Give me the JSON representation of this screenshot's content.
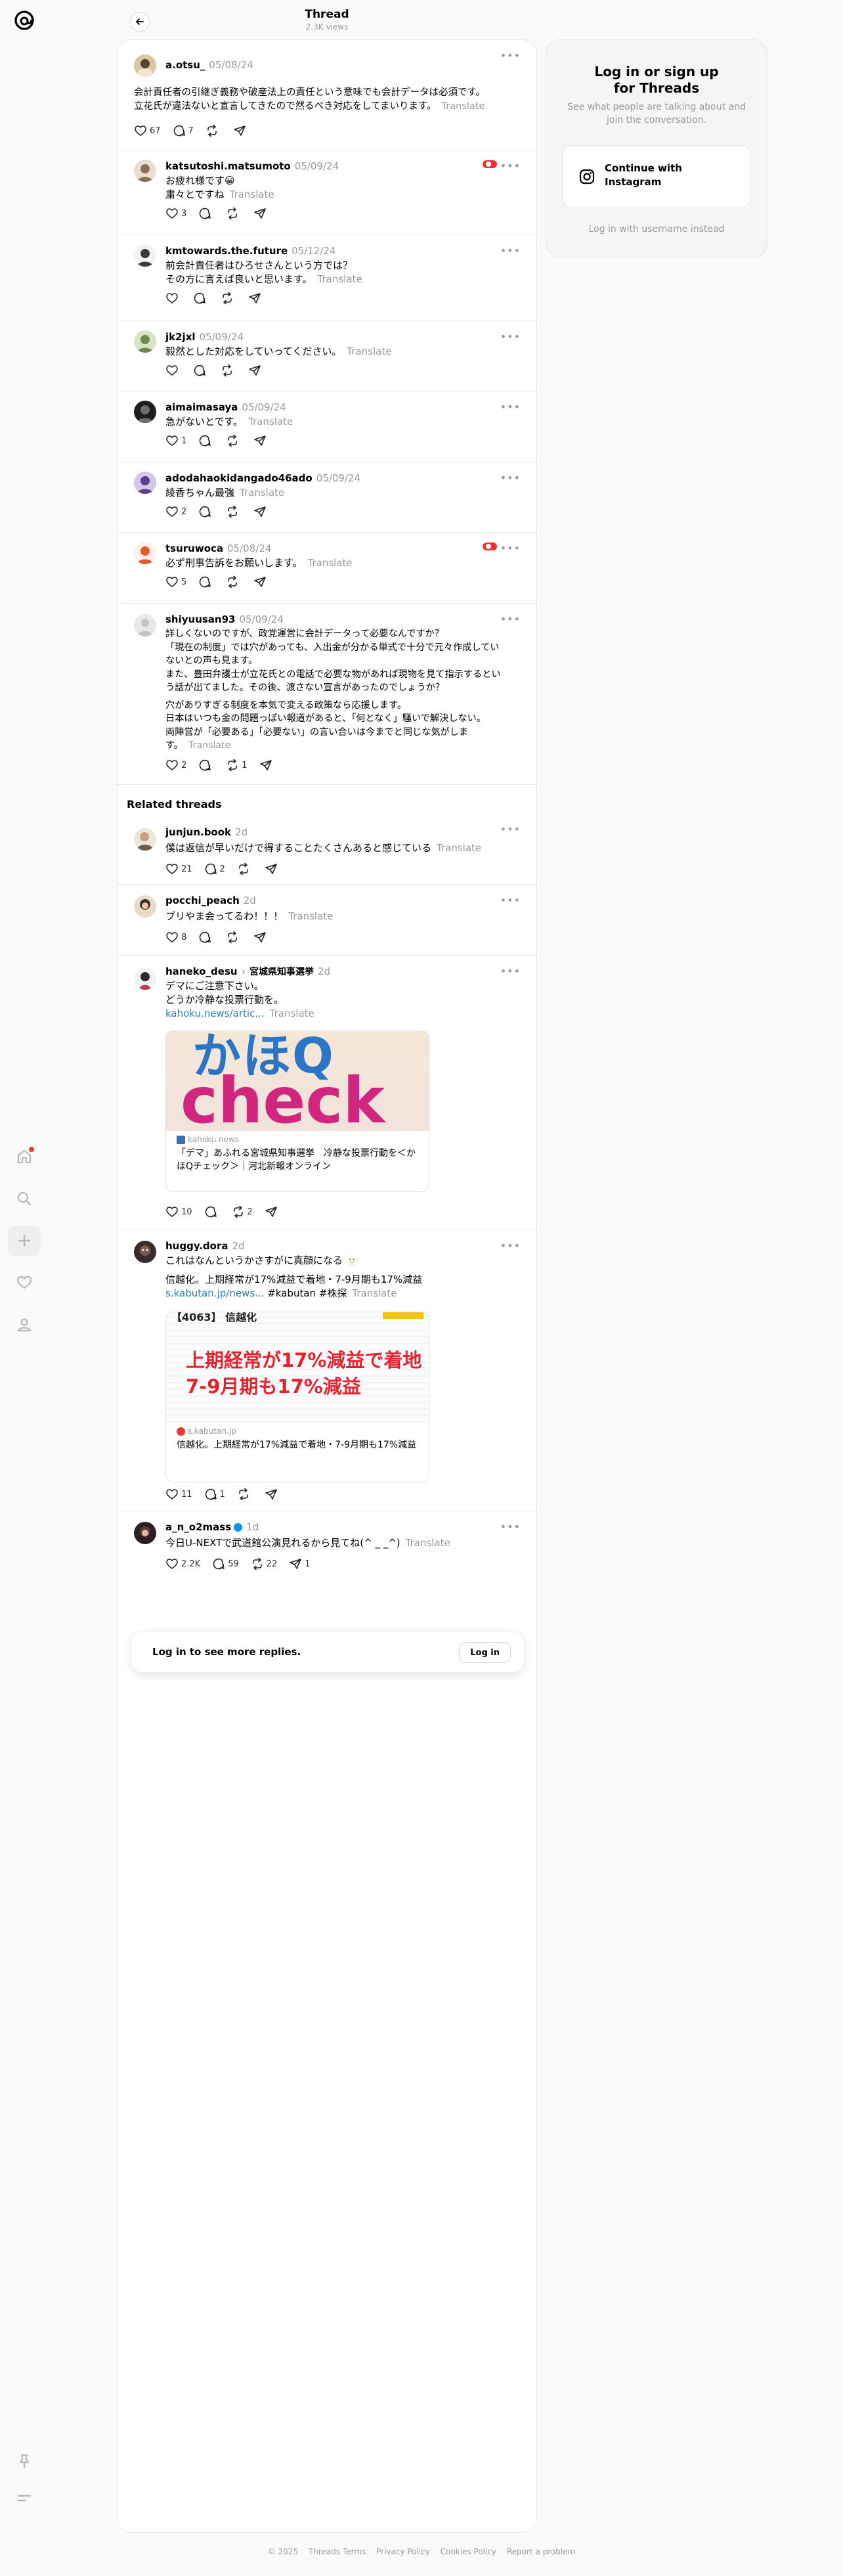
{
  "header": {
    "title": "Thread",
    "views": "2.3K views"
  },
  "main_post": {
    "username": "a.otsu_",
    "date": "05/08/24",
    "text_1": "会計責任者の引継ぎ義務や破産法上の責任という意味でも会計データは必須です。",
    "text_2": "立花氏が違法ないと宣言してきたので然るべき対応をしてまいります。",
    "translate": "Translate",
    "likes": "67",
    "replies": "7"
  },
  "replies": [
    {
      "username": "katsutoshi.matsumoto",
      "date": "05/09/24",
      "lines": [
        "お疲れ様です😀",
        "粛々とですね"
      ],
      "likes": "3"
    },
    {
      "username": "kmtowards.the.future",
      "date": "05/12/24",
      "lines": [
        "前会計責任者はひろせさんという方では？",
        "その方に言えば良いと思います。"
      ],
      "likes": ""
    },
    {
      "username": "jk2jxl",
      "date": "05/09/24",
      "lines": [
        "毅然とした対応をしていってください。"
      ],
      "likes": ""
    },
    {
      "username": "aimaimasaya",
      "date": "05/09/24",
      "lines": [
        "急がないとです。"
      ],
      "likes": "1"
    },
    {
      "username": "adodahaokidangado46ado",
      "date": "05/09/24",
      "lines": [
        "綾香ちゃん最強"
      ],
      "likes": "2"
    },
    {
      "username": "tsuruwoca",
      "date": "05/08/24",
      "lines": [
        "必ず刑事告訴をお願いします。"
      ],
      "likes": "5"
    }
  ],
  "long_reply": {
    "username": "shiyuusan93",
    "date": "05/09/24",
    "lines": [
      "詳しくないのですが、政党運営に会計データって必要なんですか？",
      "「現在の制度」では穴があっても、入出金が分かる単式で十分で元々作成してい",
      "ないとの声も見ます。",
      "また、豊田弁護士が立花氏との電話で必要な物があれば現物を見て指示するとい",
      "う話が出てました。その後、渡さない宣言があったのでしょうか？",
      "穴がありすぎる制度を本気で変える政策なら応援します。",
      "日本はいつも金の問題っぽい報道があると、「何となく」騒いで解決しない。",
      "両陣営が「必要ある」「必要ない」の言い合いは今までと同じな気がしま",
      "す。"
    ],
    "likes": "2",
    "reposts": "1"
  },
  "related_heading": "Related threads",
  "related": [
    {
      "username": "junjun.book",
      "date": "2d",
      "text": "僕は返信が早いだけで得することたくさんあると感じている",
      "likes": "21",
      "replies": "2"
    },
    {
      "username": "pocchi_peach",
      "date": "2d",
      "text": "ブリやま会ってるわ！！！",
      "likes": "8",
      "replies": ""
    },
    {
      "username": "haneko_desu",
      "reply_to": "宮城県知事選挙",
      "date": "2d",
      "lines": [
        "デマにご注意下さい。",
        "どうか冷静な投票行動を。"
      ],
      "link": "kahoku.news/artic...",
      "card_img_text_1": "かほQ",
      "card_img_text_2": "check",
      "card_domain": "kahoku.news",
      "card_title": "「デマ」あふれる宮城県知事選挙　冷静な投票行動を＜かほQチェック＞｜河北新報オンライン",
      "likes": "10",
      "reposts": "2"
    },
    {
      "username": "huggy.dora",
      "date": "2d",
      "line": "これはなんというかさすがに真顔になる 🫥",
      "text_2": "信越化。上期経常が17%減益で着地・7-9月期も17%減益",
      "link": "s.kabutan.jp/news...",
      "tags": "#kabutan #株探",
      "card_img_top": "【4063】 信越化",
      "card_img_text_1": "上期経常が17%減益で着地・",
      "card_img_text_2": "7-9月期も17%減益",
      "card_domain": "s.kabutan.jp",
      "card_title": "信越化。上期経常が17%減益で着地・7-9月期も17%減益",
      "likes": "11",
      "replies": "1"
    },
    {
      "username": "a_n_o2mass",
      "date": "1d",
      "text": "今日U-NEXTで武道館公演見れるから見てね(^ _ _^)",
      "likes": "2.2K",
      "replies": "59",
      "reposts": "22",
      "shares": "1"
    }
  ],
  "login_bar": {
    "text": "Log in to see more replies.",
    "button": "Log in"
  },
  "panel": {
    "heading_1": "Log in or sign up",
    "heading_2": "for Threads",
    "sub": "See what people are talking about and join the conversation.",
    "ig_1": "Continue with",
    "ig_2": "Instagram",
    "alt": "Log in with username instead"
  },
  "footer": [
    "© 2025",
    "Threads Terms",
    "Privacy Policy",
    "Cookies Policy",
    "Report a problem"
  ],
  "colors": {
    "accent_blue": "#0095f6",
    "notify_red": "#ff3040",
    "muted": "#999999"
  }
}
